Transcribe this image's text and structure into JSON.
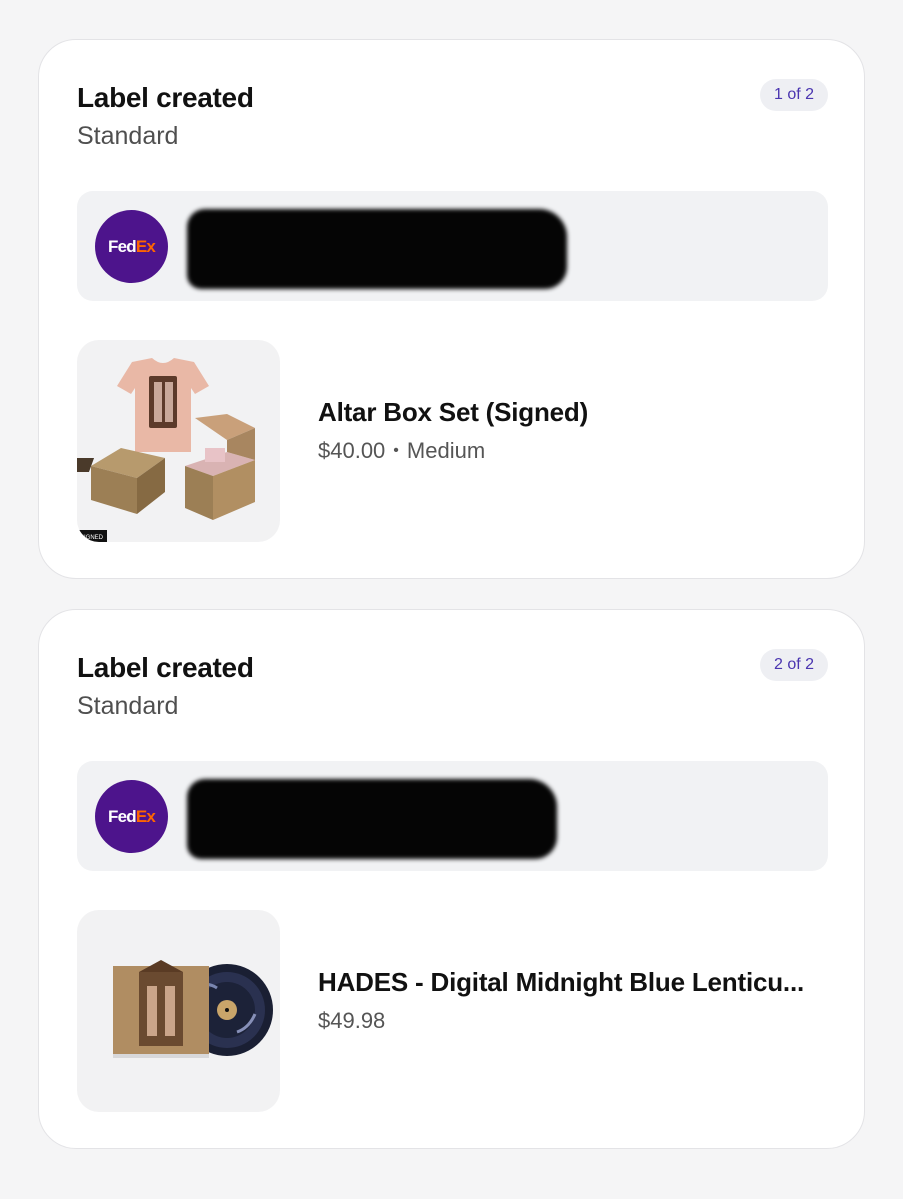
{
  "shipments": [
    {
      "status": "Label created",
      "service": "Standard",
      "badge": "1 of 2",
      "carrier": {
        "logo_text_fed": "Fed",
        "logo_text_ex": "Ex",
        "brand_color": "#4d148c",
        "accent_color": "#ff6600"
      },
      "product": {
        "name": "Altar Box Set (Signed)",
        "price": "$40.00",
        "variant": "Medium",
        "separator": "•",
        "thumb_label": "SIGNED"
      }
    },
    {
      "status": "Label created",
      "service": "Standard",
      "badge": "2 of 2",
      "carrier": {
        "logo_text_fed": "Fed",
        "logo_text_ex": "Ex",
        "brand_color": "#4d148c",
        "accent_color": "#ff6600"
      },
      "product": {
        "name": "HADES - Digital Midnight Blue Lenticu...",
        "price": "$49.98"
      }
    }
  ],
  "colors": {
    "badge_text": "#4a35b0",
    "background": "#f5f5f6",
    "card": "#ffffff"
  }
}
